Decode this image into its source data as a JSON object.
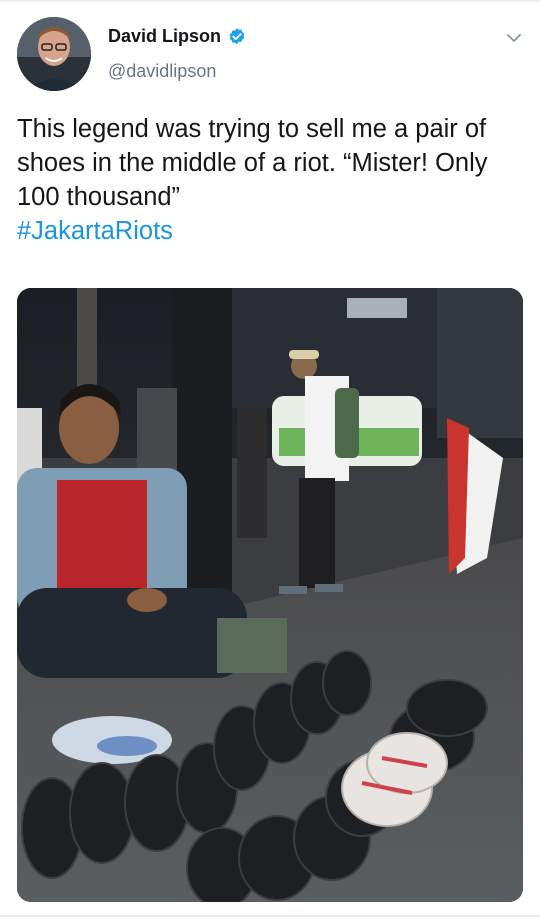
{
  "tweet": {
    "author_name": "David Lipson",
    "author_handle": "@davidlipson",
    "text": "This legend was trying to sell me a pair of shoes in the middle of a riot. “Mister! Only 100 thousand”\n",
    "hashtag": "#JakartaRiots"
  },
  "icons": {
    "verified": "verified-badge-icon",
    "menu": "chevron-down-icon"
  },
  "colors": {
    "text": "#14171a",
    "secondary": "#657786",
    "link": "#1b95e0",
    "verified": "#1da1f2"
  }
}
